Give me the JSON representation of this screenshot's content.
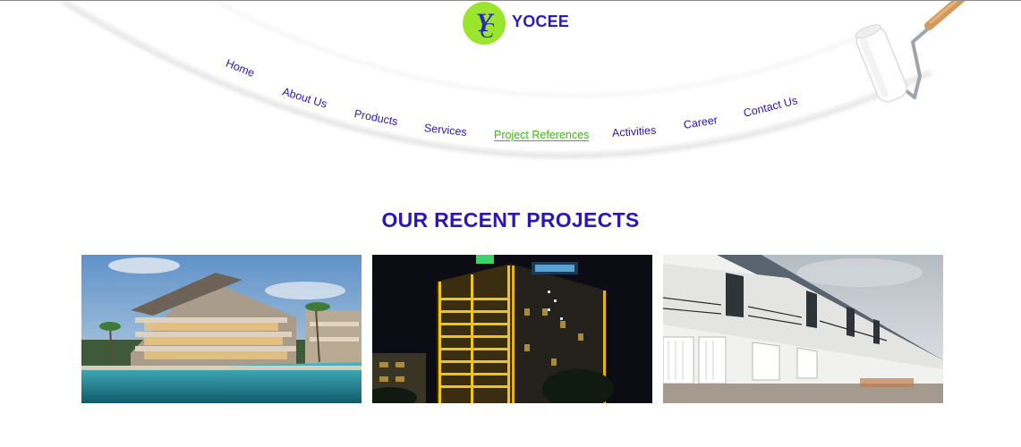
{
  "header": {
    "brand": "YOCEE",
    "logo_monogram": "YC",
    "logo_color": "#9be52e",
    "brand_color": "#2a1bc4"
  },
  "nav": {
    "items": [
      {
        "label": "Home",
        "active": false
      },
      {
        "label": "About Us",
        "active": false
      },
      {
        "label": "Products",
        "active": false
      },
      {
        "label": "Services",
        "active": false
      },
      {
        "label": "Project References",
        "active": true
      },
      {
        "label": "Activities",
        "active": false
      },
      {
        "label": "Career",
        "active": false
      },
      {
        "label": "Contact Us",
        "active": false
      }
    ],
    "active_color": "#3dbb13",
    "link_color": "#2a17b8"
  },
  "main": {
    "section_title": "OUR RECENT PROJECTS",
    "projects": [
      {
        "image": "resort-apartments-photo"
      },
      {
        "image": "night-hotel-tower-photo"
      },
      {
        "image": "townhouse-row-photo"
      }
    ]
  },
  "decoration": {
    "icon": "paint-roller-icon"
  }
}
